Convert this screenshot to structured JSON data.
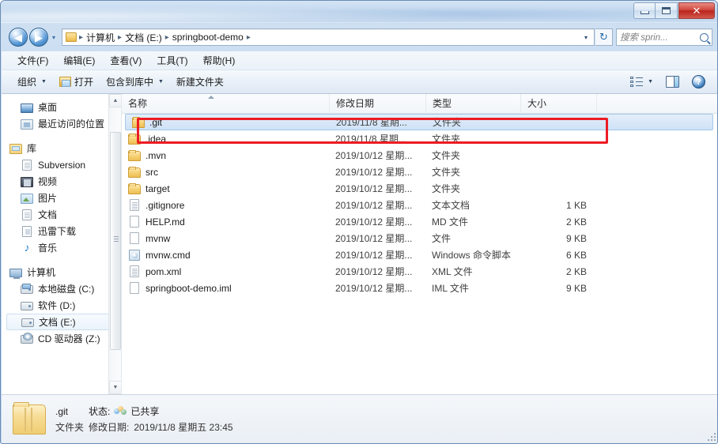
{
  "window": {
    "controls": {
      "minimize": "",
      "maximize": "",
      "close": "✕"
    }
  },
  "address": {
    "back_icon": "◀",
    "forward_icon": "▶",
    "history_caret": "▾",
    "folder_icon": "folder-icon",
    "crumbs": [
      "计算机",
      "文档 (E:)",
      "springboot-demo"
    ],
    "separator": "▸",
    "dropdown_caret": "▾",
    "refresh_icon": "↻"
  },
  "search": {
    "placeholder": "搜索 sprin...",
    "icon": "search-icon"
  },
  "menu": {
    "items": [
      "文件(F)",
      "编辑(E)",
      "查看(V)",
      "工具(T)",
      "帮助(H)"
    ]
  },
  "toolbar": {
    "organize": "组织",
    "open": "打开",
    "include_in_library": "包含到库中",
    "new_folder": "新建文件夹",
    "caret": "▼",
    "view_icon": "view-options-icon",
    "pane_icon": "preview-pane-icon",
    "help_icon": "?"
  },
  "sidebar": {
    "groups": [
      {
        "name": "favorites",
        "items": [
          {
            "label": "桌面",
            "icon": "desktop-icon",
            "selected": false
          },
          {
            "label": "最近访问的位置",
            "icon": "recent-places-icon",
            "selected": false
          }
        ]
      },
      {
        "name": "libraries",
        "header": {
          "label": "库",
          "icon": "library-icon"
        },
        "items": [
          {
            "label": "Subversion",
            "icon": "document-icon",
            "selected": false
          },
          {
            "label": "视频",
            "icon": "video-icon",
            "selected": false
          },
          {
            "label": "图片",
            "icon": "pictures-icon",
            "selected": false
          },
          {
            "label": "文档",
            "icon": "document-icon",
            "selected": false
          },
          {
            "label": "迅雷下载",
            "icon": "download-icon",
            "selected": false
          },
          {
            "label": "音乐",
            "icon": "music-icon",
            "selected": false
          }
        ]
      },
      {
        "name": "computer",
        "header": {
          "label": "计算机",
          "icon": "computer-icon"
        },
        "items": [
          {
            "label": "本地磁盘 (C:)",
            "icon": "system-drive-icon",
            "selected": false
          },
          {
            "label": "软件 (D:)",
            "icon": "drive-icon",
            "selected": false
          },
          {
            "label": "文档 (E:)",
            "icon": "drive-icon",
            "selected": true
          },
          {
            "label": "CD 驱动器 (Z:)",
            "icon": "cd-drive-icon",
            "selected": false
          }
        ]
      }
    ],
    "scrollbar": {
      "up": "▲",
      "down": "▼"
    }
  },
  "filelist": {
    "columns": [
      {
        "key": "name",
        "label": "名称",
        "sorted": true
      },
      {
        "key": "date",
        "label": "修改日期",
        "sorted": false
      },
      {
        "key": "type",
        "label": "类型",
        "sorted": false
      },
      {
        "key": "size",
        "label": "大小",
        "sorted": false
      }
    ],
    "rows": [
      {
        "name": ".git",
        "date": "2019/11/8 星期...",
        "type": "文件夹",
        "size": "",
        "icon": "folder-icon",
        "selected": true
      },
      {
        "name": ".idea",
        "date": "2019/11/8 星期...",
        "type": "文件夹",
        "size": "",
        "icon": "folder-icon",
        "selected": false
      },
      {
        "name": ".mvn",
        "date": "2019/10/12 星期...",
        "type": "文件夹",
        "size": "",
        "icon": "folder-icon",
        "selected": false
      },
      {
        "name": "src",
        "date": "2019/10/12 星期...",
        "type": "文件夹",
        "size": "",
        "icon": "folder-icon",
        "selected": false
      },
      {
        "name": "target",
        "date": "2019/10/12 星期...",
        "type": "文件夹",
        "size": "",
        "icon": "folder-icon",
        "selected": false
      },
      {
        "name": ".gitignore",
        "date": "2019/10/12 星期...",
        "type": "文本文档",
        "size": "1 KB",
        "icon": "text-file-icon",
        "selected": false
      },
      {
        "name": "HELP.md",
        "date": "2019/10/12 星期...",
        "type": "MD 文件",
        "size": "2 KB",
        "icon": "blank-file-icon",
        "selected": false
      },
      {
        "name": "mvnw",
        "date": "2019/10/12 星期...",
        "type": "文件",
        "size": "9 KB",
        "icon": "blank-file-icon",
        "selected": false
      },
      {
        "name": "mvnw.cmd",
        "date": "2019/10/12 星期...",
        "type": "Windows 命令脚本",
        "size": "6 KB",
        "icon": "command-script-icon",
        "selected": false
      },
      {
        "name": "pom.xml",
        "date": "2019/10/12 星期...",
        "type": "XML 文件",
        "size": "2 KB",
        "icon": "text-file-icon",
        "selected": false
      },
      {
        "name": "springboot-demo.iml",
        "date": "2019/10/12 星期...",
        "type": "IML 文件",
        "size": "9 KB",
        "icon": "blank-file-icon",
        "selected": false
      }
    ]
  },
  "annotation": {
    "color": "#ec1c24",
    "target": ".git"
  },
  "statusbar": {
    "name": ".git",
    "status_label": "状态:",
    "status_value": "已共享",
    "share_icon": "shared-users-icon",
    "type": "文件夹",
    "date_label": "修改日期:",
    "date_value": "2019/11/8 星期五 23:45"
  }
}
